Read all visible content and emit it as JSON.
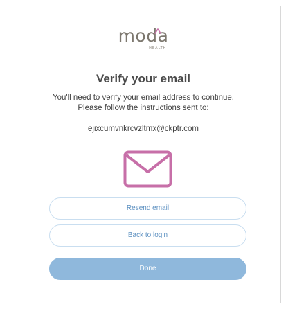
{
  "logo": {
    "word": "moda",
    "sub": "HEALTH",
    "accent_color": "#c76fa8"
  },
  "title": "Verify your email",
  "instructions": {
    "line1": "You'll need to verify your email address to continue.",
    "line2": "Please follow the instructions sent to:"
  },
  "email": "ejixcumvnkrcvzltmx@ckptr.com",
  "icon": {
    "name": "envelope-icon",
    "color": "#c76fa8"
  },
  "buttons": {
    "resend_label": "Resend email",
    "back_label": "Back to login",
    "done_label": "Done"
  },
  "colors": {
    "primary": "#8fb8dc",
    "outline_border": "#c9def0",
    "link_text": "#5b8fc0"
  }
}
